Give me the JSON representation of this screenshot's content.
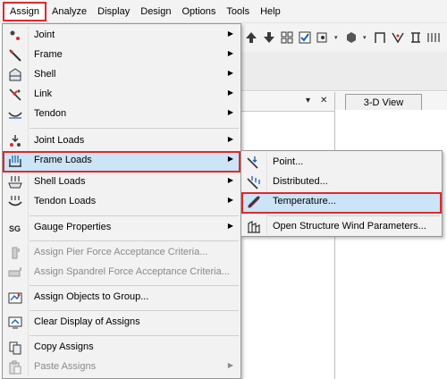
{
  "menubar": [
    "Assign",
    "Analyze",
    "Display",
    "Design",
    "Options",
    "Tools",
    "Help"
  ],
  "accent_color": "#e0282c",
  "highlight_color": "#cce4f7",
  "view_tab": "3-D View",
  "pane_controls": {
    "dropdown": "▾",
    "close": "✕"
  },
  "assign_menu": [
    {
      "label": "Joint",
      "icon": "joint-icon",
      "submenu": true,
      "enabled": true
    },
    {
      "label": "Frame",
      "icon": "frame-icon",
      "submenu": true,
      "enabled": true
    },
    {
      "label": "Shell",
      "icon": "shell-icon",
      "submenu": true,
      "enabled": true
    },
    {
      "label": "Link",
      "icon": "link-icon",
      "submenu": true,
      "enabled": true
    },
    {
      "label": "Tendon",
      "icon": "tendon-icon",
      "submenu": true,
      "enabled": true
    },
    {
      "label": "Joint Loads",
      "icon": "joint-loads-icon",
      "submenu": true,
      "enabled": true
    },
    {
      "label": "Frame Loads",
      "icon": "frame-loads-icon",
      "submenu": true,
      "enabled": true,
      "highlighted": true
    },
    {
      "label": "Shell Loads",
      "icon": "shell-loads-icon",
      "submenu": true,
      "enabled": true
    },
    {
      "label": "Tendon Loads",
      "icon": "tendon-loads-icon",
      "submenu": true,
      "enabled": true
    },
    {
      "label": "Gauge Properties",
      "icon": "gauge-icon",
      "submenu": true,
      "enabled": true
    },
    {
      "label": "Assign Pier Force Acceptance Criteria...",
      "icon": "pier-icon",
      "submenu": false,
      "enabled": false
    },
    {
      "label": "Assign Spandrel Force Acceptance Criteria...",
      "icon": "spandrel-icon",
      "submenu": false,
      "enabled": false
    },
    {
      "label": "Assign Objects to Group...",
      "icon": "group-icon",
      "submenu": false,
      "enabled": true
    },
    {
      "label": "Clear Display of Assigns",
      "icon": "clear-display-icon",
      "submenu": false,
      "enabled": true
    },
    {
      "label": "Copy Assigns",
      "icon": "copy-icon",
      "submenu": false,
      "enabled": true
    },
    {
      "label": "Paste Assigns",
      "icon": "paste-icon",
      "submenu": true,
      "enabled": false
    }
  ],
  "frame_loads_submenu": [
    {
      "label": "Point...",
      "icon": "point-load-icon",
      "highlighted": false
    },
    {
      "label": "Distributed...",
      "icon": "distributed-load-icon",
      "highlighted": false
    },
    {
      "label": "Temperature...",
      "icon": "temperature-icon",
      "highlighted": true
    },
    {
      "label": "Open Structure Wind Parameters...",
      "icon": "wind-icon",
      "highlighted": false
    }
  ],
  "gauge_icon_text": "SG"
}
